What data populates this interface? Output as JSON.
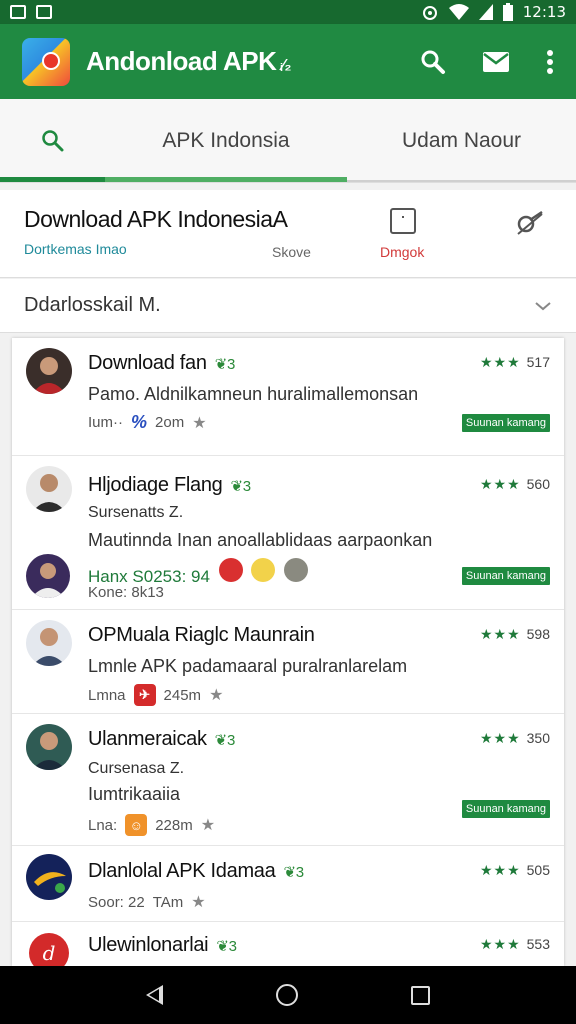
{
  "status": {
    "time": "12:13"
  },
  "app": {
    "title": "Andonload APK",
    "title_suffix": "ᵢ⁄₂"
  },
  "tabs": [
    {
      "label": "APK Indonsia"
    },
    {
      "label": "Udam Naour"
    }
  ],
  "header": {
    "title": "Download APK IndonesiaA",
    "subtitle": "Dortkemas Imao",
    "save_label": "Skove",
    "check_label": "Dmgok"
  },
  "dropdown": {
    "value": "Ddarlosskail M."
  },
  "items": [
    {
      "title": "Download fan",
      "count": "3",
      "rating": "517",
      "line1": "Pamo. Aldnilkamneun huralimallemonsan",
      "meta_prefix": "Ium··",
      "meta_size": "2om",
      "badge": "Suunan kamang"
    },
    {
      "title": "Hljodiage Flang",
      "count": "3",
      "rating": "560",
      "line1": "Sursenatts Z.",
      "line2": "Mautinnda Inan anoallablidaas aarpaonkan",
      "tag": "Hanx S0253: 94",
      "meta_prefix": "Kone: 8k13",
      "badge": "Suunan kamang"
    },
    {
      "title": "OPMuala Riaglc Maunrain",
      "count": "",
      "rating": "598",
      "line1": "Lmnle APK padamaaral puralranlarelam",
      "meta_prefix": "Lmna",
      "meta_size": "245m"
    },
    {
      "title": "Ulanmeraicak",
      "count": "3",
      "rating": "350",
      "line1": "Cursenasa Z.",
      "line2": "Iumtrikaaiia",
      "meta_prefix": "Lna:",
      "meta_size": "228m",
      "badge": "Suunan kamang"
    },
    {
      "title": "Dlanlolal APK Idamaa",
      "count": "3",
      "rating": "505",
      "meta_prefix": "Soor: 22",
      "meta_size": "TAm"
    },
    {
      "title": "Ulewinlonarlai",
      "count": "3",
      "rating": "553"
    }
  ],
  "colors": {
    "appbar": "#208a42",
    "statusbar": "#17692f",
    "accent": "#1f8a40",
    "badge": "#1f8a40"
  },
  "icons": [
    "search-icon",
    "mail-icon",
    "more-icon",
    "save-icon",
    "share-icon",
    "chevron-down-icon"
  ]
}
